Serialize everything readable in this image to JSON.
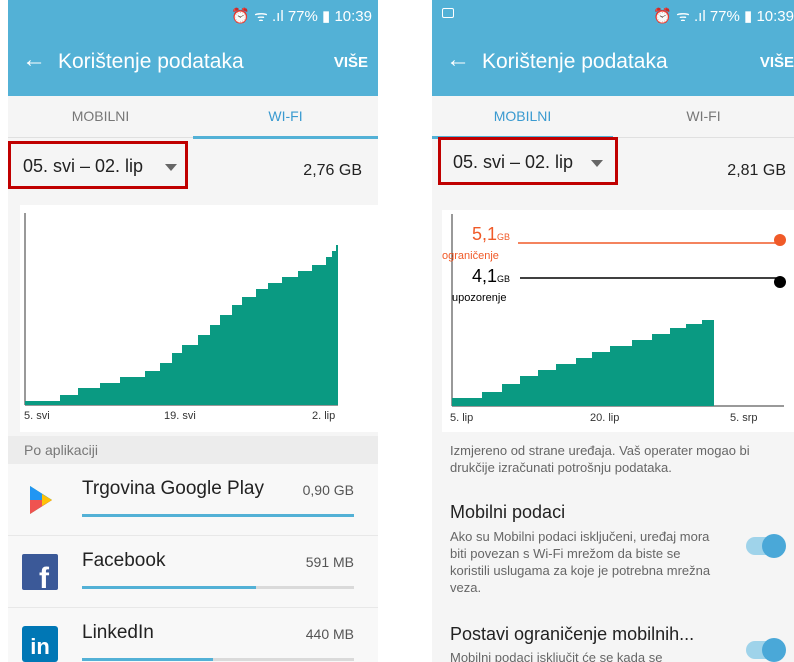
{
  "left": {
    "status": {
      "text": "⏰ ᯤ .ıl 77% ▮ 10:39"
    },
    "appbar": {
      "title": "Korištenje podataka",
      "more": "VIŠE"
    },
    "tabs": [
      {
        "label": "MOBILNI"
      },
      {
        "label": "WI-FI"
      }
    ],
    "active_tab": "WI-FI",
    "period": {
      "label": "05. svi – 02. lip"
    },
    "total": "2,76 GB",
    "axis": {
      "start": "5. svi",
      "mid": "19. svi",
      "end": "2. lip"
    },
    "section_title": "Po aplikaciji",
    "apps": [
      {
        "name": "Trgovina Google Play",
        "amount": "0,90 GB",
        "usage_fraction": 1.0,
        "icon": "google-play-icon"
      },
      {
        "name": "Facebook",
        "amount": "591 MB",
        "usage_fraction": 0.64,
        "icon": "facebook-icon"
      },
      {
        "name": "LinkedIn",
        "amount": "440 MB",
        "usage_fraction": 0.48,
        "icon": "linkedin-icon"
      }
    ]
  },
  "right": {
    "status": {
      "text": "⏰ ᯤ .ıl 77% ▮ 10:39"
    },
    "appbar": {
      "title": "Korištenje podataka",
      "more": "VIŠE"
    },
    "tabs": [
      {
        "label": "MOBILNI"
      },
      {
        "label": "WI-FI"
      }
    ],
    "active_tab": "MOBILNI",
    "period": {
      "label": "05. svi – 02. lip"
    },
    "total": "2,81 GB",
    "limit": {
      "value": "5,1",
      "unit": "GB",
      "label": "ograničenje"
    },
    "warning": {
      "value": "4,1",
      "unit": "GB",
      "label": "upozorenje"
    },
    "axis": {
      "start": "5. lip",
      "mid": "20. lip",
      "end": "5. srp"
    },
    "note": "Izmjereno od strane uređaja. Vaš operater mogao bi drukčije izračunati potrošnju podataka.",
    "settings": [
      {
        "title": "Mobilni podaci",
        "desc": "Ako su Mobilni podaci isključeni, uređaj mora biti povezan s Wi-Fi mrežom da biste se koristili uslugama za koje je potrebna mrežna veza.",
        "enabled": true
      },
      {
        "title": "Postavi ograničenje mobilnih...",
        "desc": "Mobilni podaci isključit će se kada se",
        "enabled": true
      }
    ]
  },
  "colors": {
    "accent": "#53b1d6",
    "chart_fill": "#0a9a82",
    "limit": "#f05a28",
    "warning": "#000000",
    "highlight_box": "#c00000"
  }
}
